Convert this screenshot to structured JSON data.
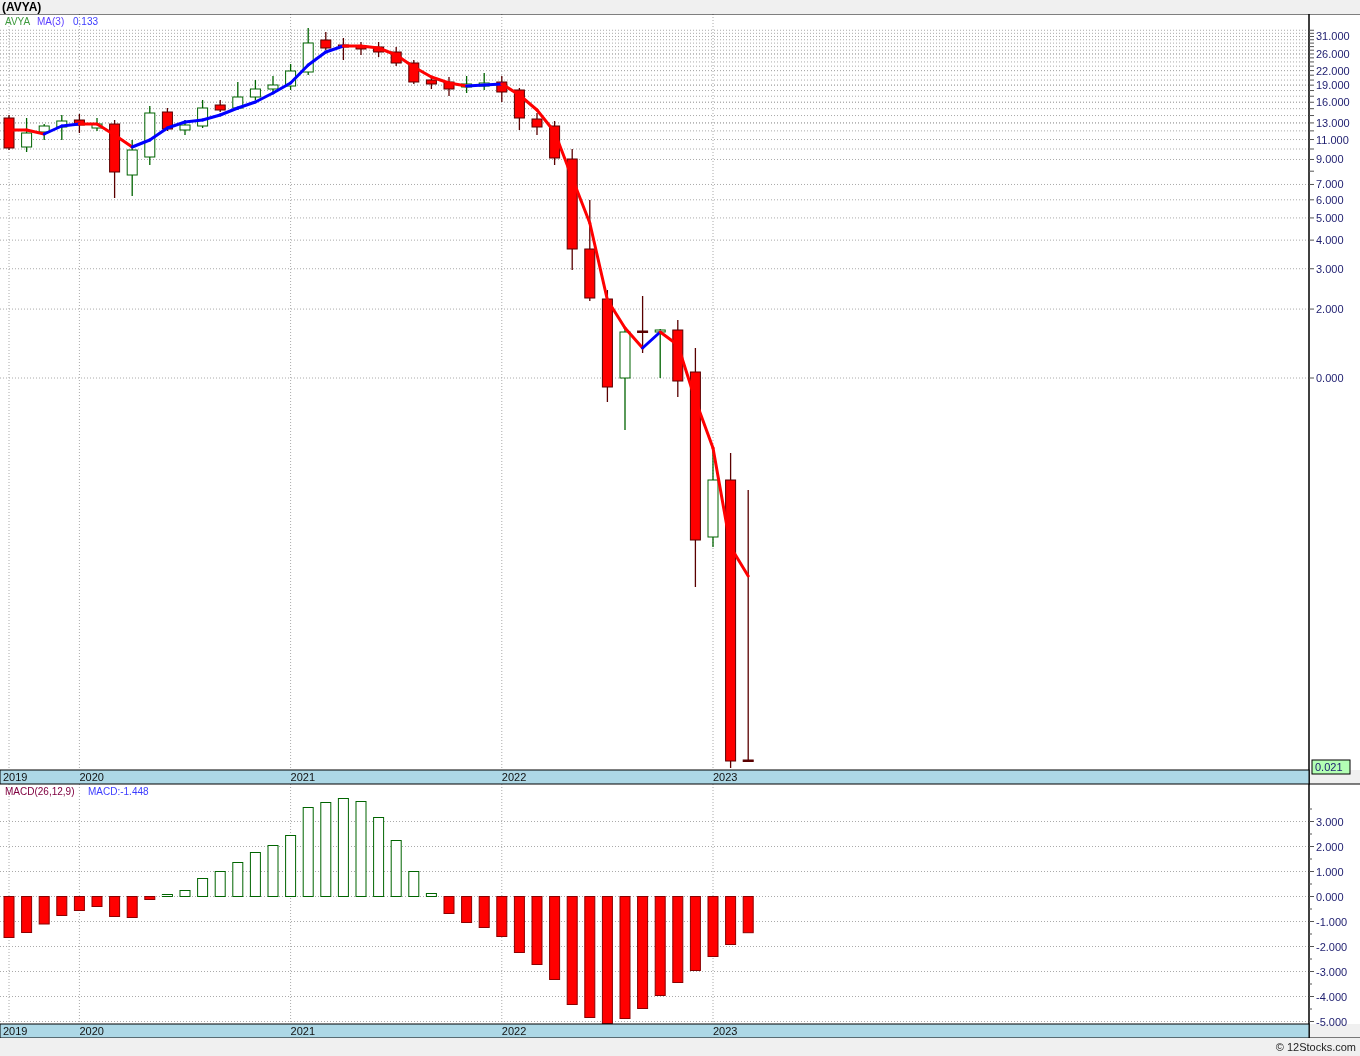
{
  "title": "(AVYA)",
  "price_chart": {
    "legend": {
      "symbol": "AVYA",
      "indicator": "MA(3)",
      "indicator_value": "0.133"
    },
    "axis_labels": [
      "31.000",
      "26.000",
      "22.000",
      "19.000",
      "16.000",
      "13.000",
      "11.000",
      "9.000",
      "7.000",
      "6.000",
      "5.000",
      "4.000",
      "3.000",
      "2.000",
      "0.000"
    ],
    "last_price": "0.021",
    "year_labels": [
      "2019",
      "2020",
      "2021",
      "2022",
      "2023"
    ]
  },
  "macd_chart": {
    "legend": {
      "name": "MACD(26,12,9)",
      "reading": "MACD:-1.448"
    },
    "year_labels": [
      "2019",
      "2020",
      "2021",
      "2022",
      "2023"
    ],
    "axis_labels": [
      "3.000",
      "2.000",
      "1.000",
      "0.000",
      "-1.000",
      "-2.000",
      "-3.000",
      "-4.000",
      "-5.000"
    ]
  },
  "footer": "© 12Stocks.com"
}
